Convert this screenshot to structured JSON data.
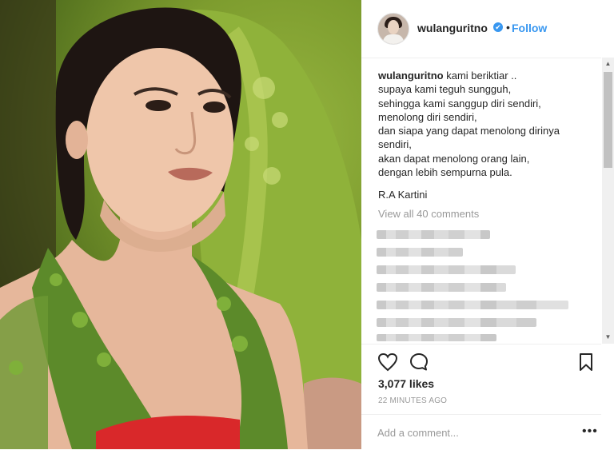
{
  "post": {
    "username": "wulanguritno",
    "verified_badge": "✔",
    "separator": "•",
    "follow_label": "Follow"
  },
  "caption": {
    "username": "wulanguritno",
    "first_line": "kami beriktiar ..",
    "lines": [
      "supaya kami teguh sungguh,",
      "sehingga kami sanggup diri sendiri,",
      "menolong diri sendiri,",
      "dan siapa yang dapat menolong dirinya",
      "sendiri,",
      "akan dapat menolong orang lain,",
      "dengan lebih sempurna pula."
    ],
    "signature": "R.A Kartini"
  },
  "comments": {
    "view_all_label": "View all 40 comments"
  },
  "actions": {
    "like_icon": "heart-icon",
    "comment_icon": "speech-bubble-icon",
    "save_icon": "bookmark-icon"
  },
  "likes": "3,077 likes",
  "timestamp": "22 MINUTES AGO",
  "comment_box": {
    "placeholder": "Add a comment...",
    "more_label": "•••"
  },
  "colors": {
    "accent": "#3897f0",
    "text": "#262626",
    "muted": "#999999"
  }
}
